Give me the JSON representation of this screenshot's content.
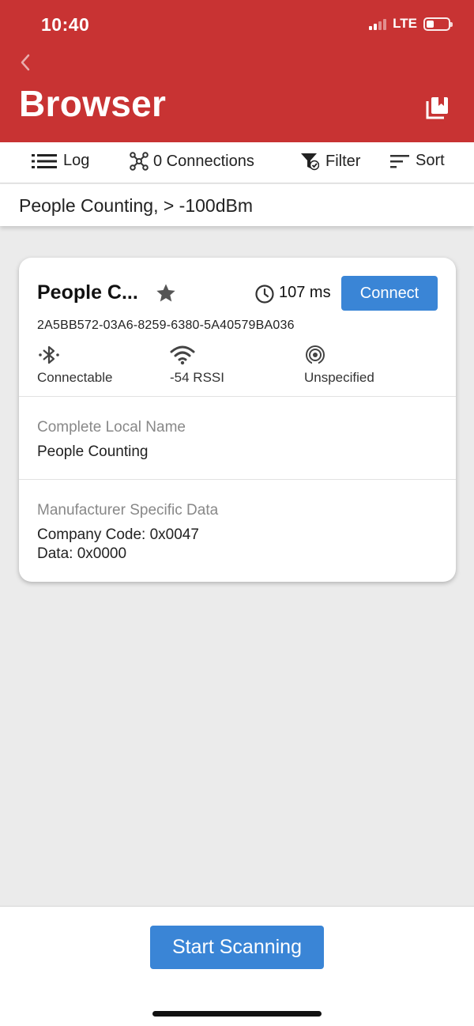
{
  "status_bar": {
    "time": "10:40",
    "network": "LTE"
  },
  "header": {
    "title": "Browser"
  },
  "toolbar": {
    "log_label": "Log",
    "connections_label": "0 Connections",
    "filter_label": "Filter",
    "sort_label": "Sort"
  },
  "filter_summary": {
    "text": "People Counting,  > -100dBm"
  },
  "device": {
    "name": "People C...",
    "interval": "107 ms",
    "connect_label": "Connect",
    "uuid": "2A5BB572-03A6-8259-6380-5A40579BA036",
    "properties": [
      {
        "icon": "bluetooth-icon",
        "label": "Connectable"
      },
      {
        "icon": "wifi-signal-icon",
        "label": "-54 RSSI"
      },
      {
        "icon": "broadcast-icon",
        "label": "Unspecified"
      }
    ],
    "sections": [
      {
        "title": "Complete Local Name",
        "lines": [
          "People Counting"
        ]
      },
      {
        "title": "Manufacturer Specific Data",
        "lines": [
          "Company Code: 0x0047",
          "Data: 0x0000"
        ]
      }
    ]
  },
  "footer": {
    "scan_label": "Start Scanning"
  },
  "colors": {
    "header_red": "#c83333",
    "button_blue": "#3a85d6"
  }
}
